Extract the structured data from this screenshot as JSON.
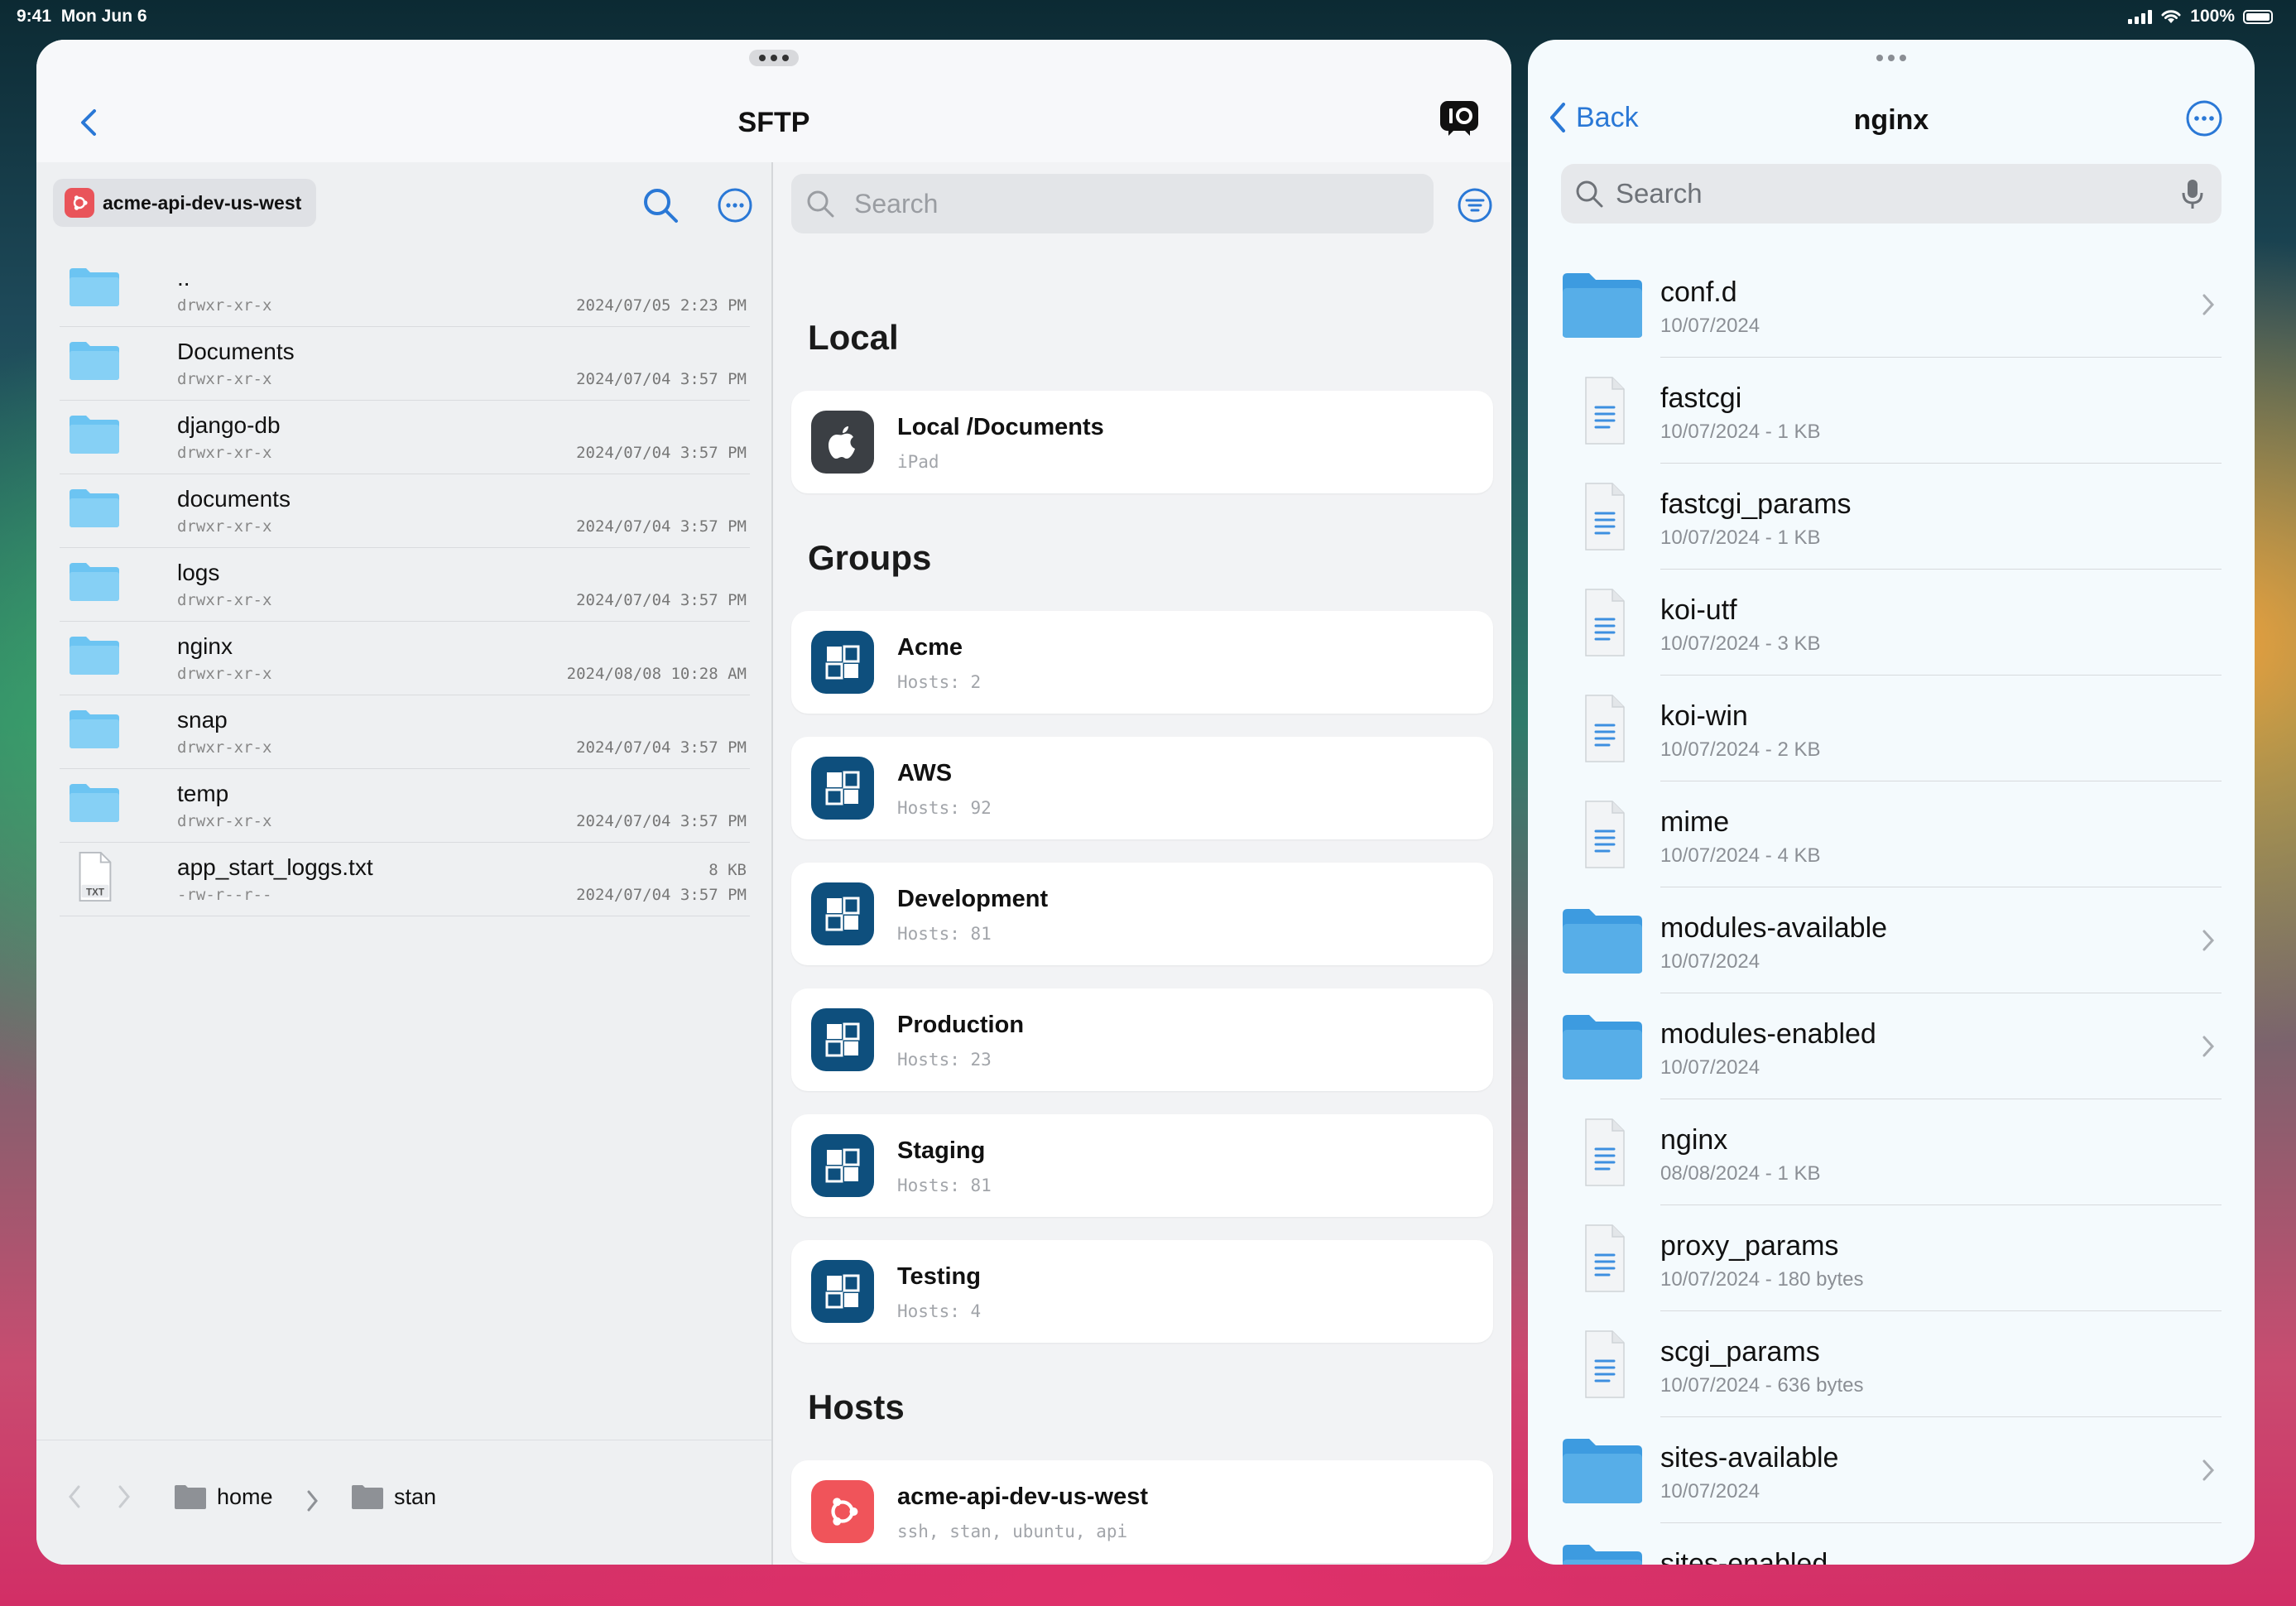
{
  "status_bar": {
    "time": "9:41",
    "date": "Mon Jun 6",
    "battery": "100%"
  },
  "left_window": {
    "title": "SFTP",
    "host_chip": "acme-api-dev-us-west",
    "files": [
      {
        "name": "..",
        "perm": "drwxr-xr-x",
        "date": "2024/07/05 2:23 PM",
        "type": "folder"
      },
      {
        "name": "Documents",
        "perm": "drwxr-xr-x",
        "date": "2024/07/04 3:57 PM",
        "type": "folder"
      },
      {
        "name": "django-db",
        "perm": "drwxr-xr-x",
        "date": "2024/07/04 3:57 PM",
        "type": "folder"
      },
      {
        "name": "documents",
        "perm": "drwxr-xr-x",
        "date": "2024/07/04 3:57 PM",
        "type": "folder"
      },
      {
        "name": "logs",
        "perm": "drwxr-xr-x",
        "date": "2024/07/04 3:57 PM",
        "type": "folder"
      },
      {
        "name": "nginx",
        "perm": "drwxr-xr-x",
        "date": "2024/08/08 10:28 AM",
        "type": "folder"
      },
      {
        "name": "snap",
        "perm": "drwxr-xr-x",
        "date": "2024/07/04 3:57 PM",
        "type": "folder"
      },
      {
        "name": "temp",
        "perm": "drwxr-xr-x",
        "date": "2024/07/04 3:57 PM",
        "type": "folder"
      },
      {
        "name": "app_start_loggs.txt",
        "perm": "-rw-r--r--",
        "date": "2024/07/04 3:57 PM",
        "size": "8 KB",
        "type": "txt",
        "badge": "TXT"
      }
    ],
    "breadcrumb": [
      "home",
      "stan"
    ],
    "connections": {
      "search_placeholder": "Search",
      "local_header": "Local",
      "local": {
        "title": "Local /Documents",
        "sub": "iPad"
      },
      "groups_header": "Groups",
      "groups": [
        {
          "title": "Acme",
          "sub": "Hosts: 2"
        },
        {
          "title": "AWS",
          "sub": "Hosts: 92"
        },
        {
          "title": "Development",
          "sub": "Hosts: 81"
        },
        {
          "title": "Production",
          "sub": "Hosts: 23"
        },
        {
          "title": "Staging",
          "sub": "Hosts: 81"
        },
        {
          "title": "Testing",
          "sub": "Hosts: 4"
        }
      ],
      "hosts_header": "Hosts",
      "hosts": [
        {
          "title": "acme-api-dev-us-west",
          "sub": "ssh, stan, ubuntu, api"
        }
      ]
    }
  },
  "right_window": {
    "back_label": "Back",
    "title": "nginx",
    "search_placeholder": "Search",
    "items": [
      {
        "name": "conf.d",
        "meta": "10/07/2024",
        "type": "folder"
      },
      {
        "name": "fastcgi",
        "meta": "10/07/2024 - 1 KB",
        "type": "file"
      },
      {
        "name": "fastcgi_params",
        "meta": "10/07/2024 - 1 KB",
        "type": "file"
      },
      {
        "name": "koi-utf",
        "meta": "10/07/2024 - 3 KB",
        "type": "file"
      },
      {
        "name": "koi-win",
        "meta": "10/07/2024 - 2 KB",
        "type": "file"
      },
      {
        "name": "mime",
        "meta": "10/07/2024 - 4 KB",
        "type": "file"
      },
      {
        "name": "modules-available",
        "meta": "10/07/2024",
        "type": "folder"
      },
      {
        "name": "modules-enabled",
        "meta": "10/07/2024",
        "type": "folder"
      },
      {
        "name": "nginx",
        "meta": "08/08/2024 - 1 KB",
        "type": "file"
      },
      {
        "name": "proxy_params",
        "meta": "10/07/2024 - 180 bytes",
        "type": "file"
      },
      {
        "name": "scgi_params",
        "meta": "10/07/2024 - 636 bytes",
        "type": "file"
      },
      {
        "name": "sites-available",
        "meta": "10/07/2024",
        "type": "folder"
      },
      {
        "name": "sites-enabled",
        "meta": "",
        "type": "folder"
      }
    ]
  },
  "colors": {
    "accent": "#2a78d6",
    "folder": "#6cc4f2",
    "group_icon": "#0e4f7d",
    "ubuntu": "#f0545a"
  }
}
